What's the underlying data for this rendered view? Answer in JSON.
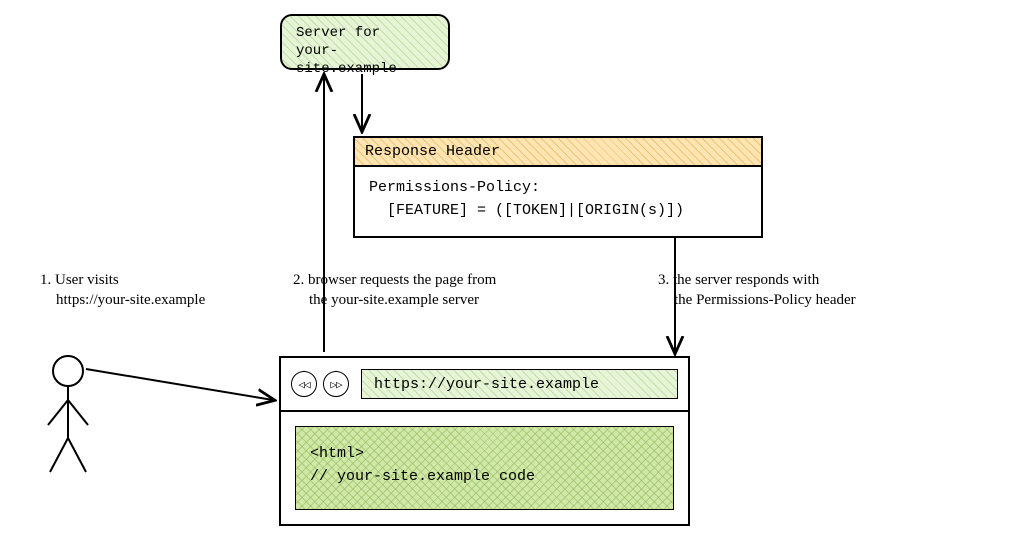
{
  "server": {
    "line1": "Server for",
    "line2": "your-site.example"
  },
  "response": {
    "header_label": "Response Header",
    "policy_name": "Permissions-Policy:",
    "policy_value": "[FEATURE] = ([TOKEN]|[ORIGIN(s)])"
  },
  "steps": {
    "s1_line1": "1. User visits",
    "s1_line2": "https://your-site.example",
    "s2_line1": "2. browser requests the page from",
    "s2_line2": "the your-site.example server",
    "s3_line1": "3. the server responds with",
    "s3_line2": "the Permissions-Policy header"
  },
  "browser": {
    "back_icon": "◁◁",
    "fwd_icon": "▷▷",
    "url": "https://your-site.example",
    "code_line1": "<html>",
    "code_line2": "// your-site.example code"
  }
}
